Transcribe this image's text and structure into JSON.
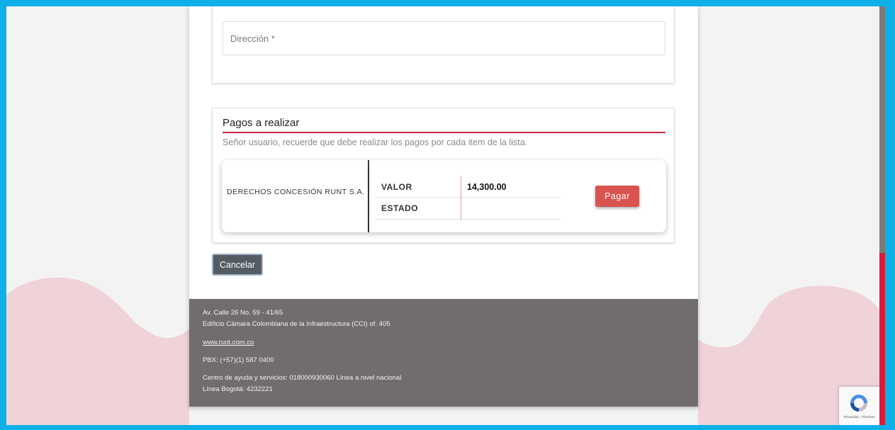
{
  "address": {
    "placeholder": "Dirección *"
  },
  "payments": {
    "title": "Pagos a realizar",
    "note": "Señor usuario, recuerde que debe realizar los pagos por cada item de la lista.",
    "items": [
      {
        "name": "DERECHOS CONCESIÓN RUNT S.A.",
        "value_label": "VALOR",
        "value": "14,300.00",
        "status_label": "ESTADO",
        "status": "",
        "pay_label": "Pagar"
      }
    ]
  },
  "actions": {
    "cancel_label": "Cancelar"
  },
  "footer": {
    "address_line1": "Av. Calle 26 No. 59 - 41/65",
    "address_line2": "Edificio Cámara Colombiana de la Infraestructura (CCI) of. 405",
    "website": "www.runt.com.co",
    "pbx": "PBX: (+57)(1) 587 0400",
    "help_line": "Centro de ayuda y servicios: 018000930060 Línea a nivel nacional",
    "bogota_line": "Línea Bogotá: 4232221"
  },
  "recaptcha": {
    "icon": "recaptcha-icon",
    "text": "Privacidad - Términos"
  },
  "colors": {
    "accent_red": "#c9243f",
    "pay_button": "#d9534f",
    "footer_bg": "#716c6d",
    "frame_blue": "#0fb0e8"
  }
}
